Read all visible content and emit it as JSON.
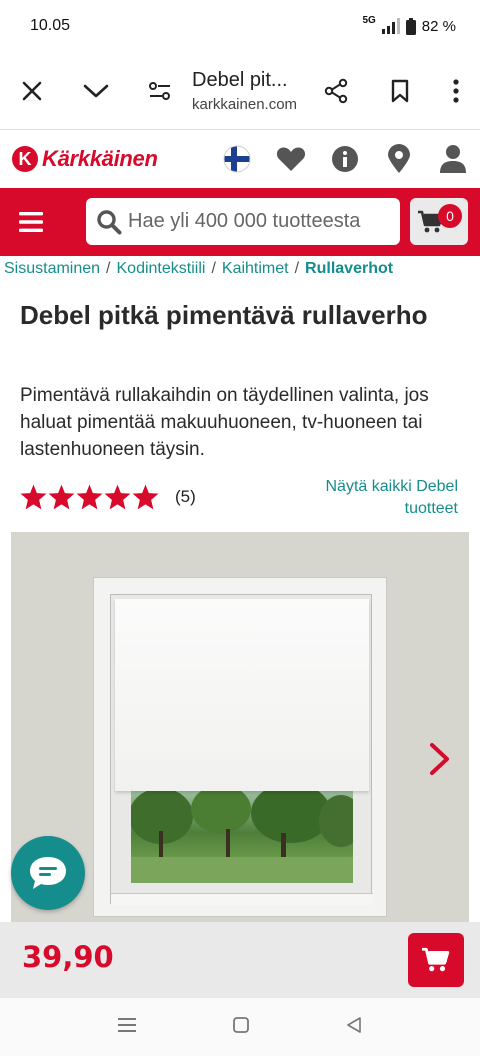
{
  "status_bar": {
    "time": "10.05",
    "network": "5G",
    "battery": "82 %"
  },
  "browser": {
    "title": "Debel pit...",
    "url": "karkkainen.com",
    "icons": [
      "close-icon",
      "chevron-down-icon",
      "page-settings-icon",
      "share-icon",
      "bookmark-icon",
      "more-vert-icon"
    ]
  },
  "site": {
    "logo_letter": "K",
    "logo_text": "Kärkkäinen",
    "header_icons": [
      "finland-flag-icon",
      "heart-icon",
      "info-icon",
      "location-pin-icon",
      "user-icon"
    ]
  },
  "search": {
    "placeholder": "Hae yli 400 000 tuotteesta",
    "cart_count": "0"
  },
  "breadcrumb": {
    "items": [
      "Sisustaminen",
      "Kodintekstiili",
      "Kaihtimet",
      "Rullaverhot"
    ],
    "separator": "/"
  },
  "product": {
    "title": "Debel pitkä pimentävä rullaverho",
    "description": "Pimentävä rullakaihdin on täydellinen valinta, jos haluat pimentää makuuhuoneen, tv-huoneen tai lastenhuoneen täysin.",
    "rating": 5,
    "rating_count": "(5)",
    "brand_link": "Näytä kaikki Debel tuotteet",
    "price": "39,90"
  },
  "colors": {
    "brand_red": "#d70a2b",
    "link_teal": "#168d8d",
    "chat_teal": "#168d8d"
  }
}
